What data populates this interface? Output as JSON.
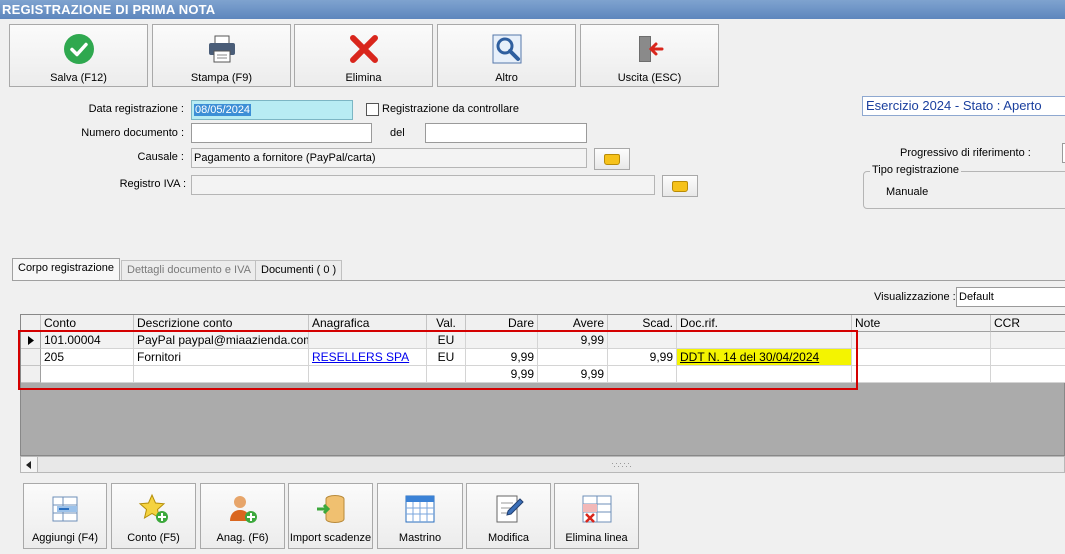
{
  "window": {
    "title": "REGISTRAZIONE DI PRIMA NOTA"
  },
  "toolbar": {
    "save": "Salva (F12)",
    "print": "Stampa (F9)",
    "delete": "Elimina",
    "other": "Altro",
    "exit": "Uscita (ESC)"
  },
  "form": {
    "data_label": "Data registrazione :",
    "data_value": "08/05/2024",
    "controllo_label": "Registrazione da controllare",
    "numdoc_label": "Numero documento :",
    "numdoc_value": "",
    "del_label": "del",
    "del_value": "",
    "causale_label": "Causale :",
    "causale_value": "Pagamento a fornitore (PayPal/carta)",
    "iva_label": "Registro IVA :",
    "iva_value": ""
  },
  "side": {
    "esercizio": "Esercizio 2024 - Stato : Aperto",
    "progressivo_label": "Progressivo di riferimento :",
    "tipo_label": "Tipo registrazione",
    "tipo_value": "Manuale"
  },
  "tabs": [
    {
      "label": "Corpo registrazione"
    },
    {
      "label": "Dettagli documento e IVA"
    },
    {
      "label": "Documenti ( 0 )"
    }
  ],
  "view": {
    "label": "Visualizzazione :",
    "value": "Default"
  },
  "grid": {
    "columns": [
      "Conto",
      "Descrizione conto",
      "Anagrafica",
      "Val.",
      "Dare",
      "Avere",
      "Scad.",
      "Doc.rif.",
      "Note",
      "CCR"
    ],
    "rows": [
      {
        "conto": "101.00004",
        "descrizione": "PayPal paypal@miaazienda.com",
        "anagrafica": "",
        "val": "EU",
        "dare": "",
        "avere": "9,99",
        "scad": "",
        "docrif": "",
        "note": "",
        "ccr": ""
      },
      {
        "conto": "205",
        "descrizione": "Fornitori",
        "anagrafica": "RESELLERS SPA",
        "val": "EU",
        "dare": "9,99",
        "avere": "",
        "scad": "9,99",
        "docrif": "DDT N. 14 del 30/04/2024",
        "note": "",
        "ccr": ""
      },
      {
        "conto": "",
        "descrizione": "",
        "anagrafica": "",
        "val": "",
        "dare": "9,99",
        "avere": "9,99",
        "scad": "",
        "docrif": "",
        "note": "",
        "ccr": ""
      }
    ]
  },
  "bottom": {
    "add": "Aggiungi (F4)",
    "account": "Conto (F5)",
    "registry": "Anag. (F6)",
    "import": "Import scadenze",
    "ledger": "Mastrino",
    "edit": "Modifica",
    "delete_line": "Elimina linea"
  },
  "colors": {
    "title_bar": "#6b90c4",
    "highlight_red": "#d40000",
    "docrif_yellow": "#f4f400",
    "link_blue": "#0000ee"
  }
}
